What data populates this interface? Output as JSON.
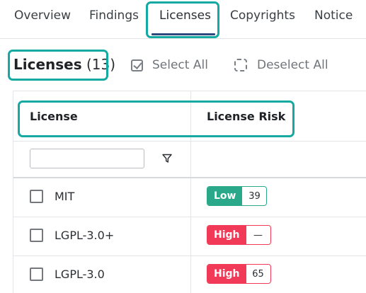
{
  "tabs": [
    {
      "label": "Overview",
      "active": false
    },
    {
      "label": "Findings",
      "active": false
    },
    {
      "label": "Licenses",
      "active": true
    },
    {
      "label": "Copyrights",
      "active": false
    },
    {
      "label": "Notice",
      "active": false
    }
  ],
  "toolbar": {
    "title": "Licenses",
    "count": "(13)",
    "select_all": "Select All",
    "deselect_all": "Deselect All"
  },
  "table": {
    "columns": [
      "License",
      "License Risk"
    ],
    "filter_placeholder": "",
    "rows": [
      {
        "name": "MIT",
        "risk": "Low",
        "risk_count": "39",
        "risk_color": "#2aa98a"
      },
      {
        "name": "LGPL-3.0+",
        "risk": "High",
        "risk_count": "—",
        "risk_color": "#f03a57"
      },
      {
        "name": "LGPL-3.0",
        "risk": "High",
        "risk_count": "65",
        "risk_color": "#f03a57"
      }
    ]
  },
  "colors": {
    "highlight": "#14aaa1",
    "tab_underline": "#2c4a7e"
  }
}
